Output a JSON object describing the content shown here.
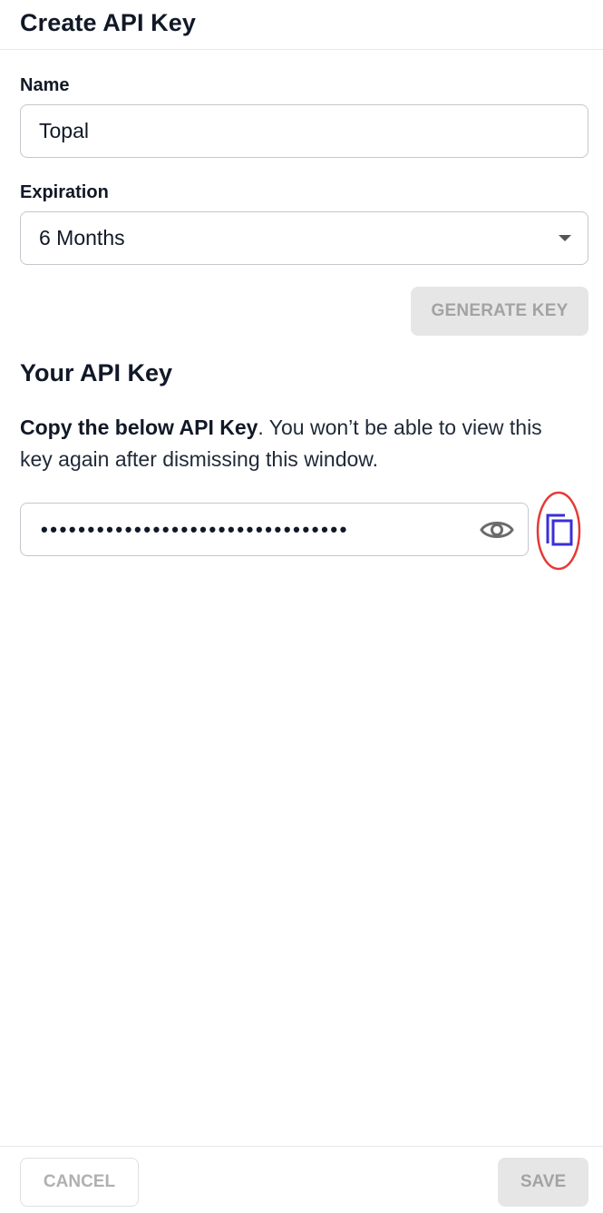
{
  "dialog": {
    "title": "Create API Key"
  },
  "form": {
    "name_label": "Name",
    "name_value": "Topal",
    "expiration_label": "Expiration",
    "expiration_value": "6 Months",
    "generate_label": "GENERATE KEY"
  },
  "api_key": {
    "section_title": "Your API Key",
    "desc_bold": "Copy the below API Key",
    "desc_rest": ". You won’t be able to view this key again after dismissing this window.",
    "masked_value": "•••••••••••••••••••••••••••••••••",
    "eye_icon": "eye-icon",
    "copy_icon": "copy-icon",
    "copy_color": "#3b2fd6",
    "highlight_color": "#e53935"
  },
  "footer": {
    "cancel_label": "CANCEL",
    "save_label": "SAVE"
  }
}
